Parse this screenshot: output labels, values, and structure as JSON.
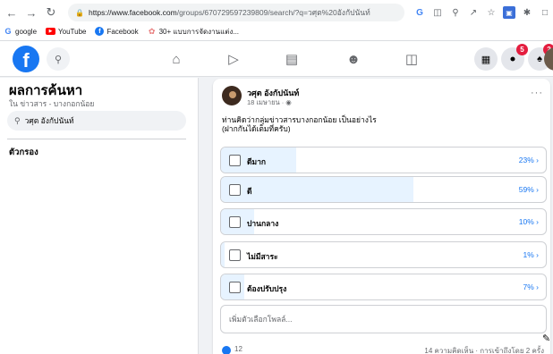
{
  "browser": {
    "url_host": "https://www.facebook.com",
    "url_rest": "/groups/670729597239809/search/?q=วศุต%20อังกัปนันท์",
    "bookmarks": [
      {
        "icon": "google-icon",
        "label": "google"
      },
      {
        "icon": "youtube-icon",
        "label": "YouTube"
      },
      {
        "icon": "facebook-icon",
        "label": "Facebook"
      },
      {
        "icon": "ad-icon",
        "label": "30+ แบบการจัดงานแต่ง..."
      }
    ]
  },
  "fb": {
    "logo": "f",
    "notifications": {
      "messenger_badge": "5",
      "bell_badge": "2"
    }
  },
  "left": {
    "title": "ผลการค้นหา",
    "subtitle": "ใน ข่าวสาร - บางกอกน้อย",
    "search_value": "วศุต อังกัปนันท์",
    "filters_label": "ตัวกรอง"
  },
  "post": {
    "author": "วศุต อังกัปนันท์",
    "date": "18 เมษายน · ",
    "text_line1": "ท่านคิดว่ากลุ่มข่าวสารบางกอกน้อย เป็นอย่างไร",
    "text_line2": "(ฝากกันได้เต็มที่ครับ)",
    "poll": [
      {
        "label": "ดีมาก",
        "percent_label": "23%",
        "value": 23
      },
      {
        "label": "ดี",
        "percent_label": "59%",
        "value": 59
      },
      {
        "label": "ปานกลาง",
        "percent_label": "10%",
        "value": 10
      },
      {
        "label": "ไม่มีสาระ",
        "percent_label": "1%",
        "value": 1
      },
      {
        "label": "ต้องปรับปรุง",
        "percent_label": "7%",
        "value": 7
      }
    ],
    "add_option_placeholder": "เพิ่มตัวเลือกโพลล์...",
    "reaction_count": "12",
    "stats": "14 ความคิดเห็น · การเข้าถึงโดย 2 ครั้ง"
  },
  "colors": {
    "brand": "#1877f2",
    "poll_fill": "#e7f3ff",
    "badge": "#e41e3f"
  }
}
